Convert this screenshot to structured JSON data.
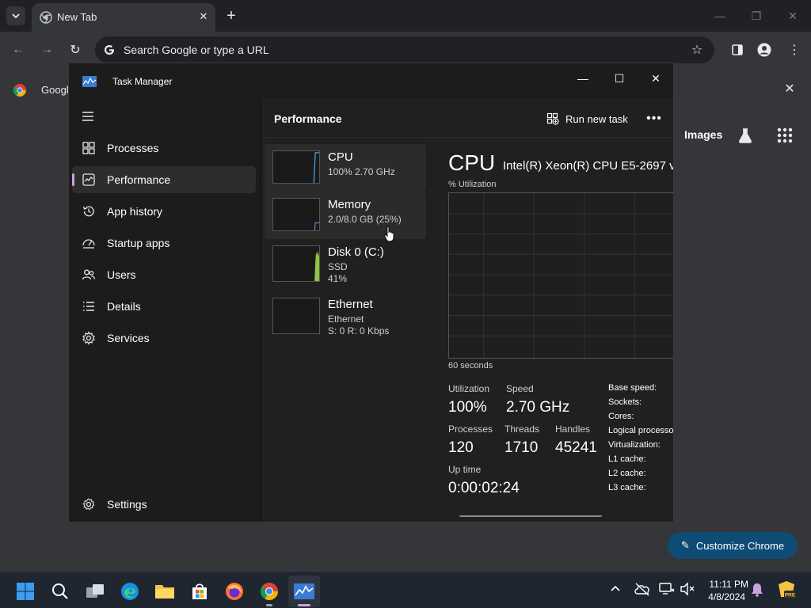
{
  "chrome": {
    "tab_title": "New Tab",
    "omnibox_placeholder": "Search Google or type a URL",
    "bookmark_label": "Googl",
    "images_label": "Images",
    "customize_label": "Customize Chrome"
  },
  "taskmanager": {
    "window_title": "Task Manager",
    "nav": [
      {
        "label": "Processes",
        "icon": "processes-icon"
      },
      {
        "label": "Performance",
        "icon": "performance-icon",
        "selected": true
      },
      {
        "label": "App history",
        "icon": "history-icon"
      },
      {
        "label": "Startup apps",
        "icon": "startup-icon"
      },
      {
        "label": "Users",
        "icon": "users-icon"
      },
      {
        "label": "Details",
        "icon": "details-icon"
      },
      {
        "label": "Services",
        "icon": "services-icon"
      }
    ],
    "settings_label": "Settings",
    "page_title": "Performance",
    "run_new_task": "Run new task",
    "resources": [
      {
        "name": "CPU",
        "line1": "100% 2.70 GHz",
        "line2": ""
      },
      {
        "name": "Memory",
        "line1": "2.0/8.0 GB (25%)",
        "line2": ""
      },
      {
        "name": "Disk 0 (C:)",
        "line1": "SSD",
        "line2": "41%"
      },
      {
        "name": "Ethernet",
        "line1": "Ethernet",
        "line2": "S: 0 R: 0 Kbps"
      }
    ],
    "cpu": {
      "title": "CPU",
      "model": "Intel(R) Xeon(R) CPU E5-2697 v",
      "util_label": "% Utilization",
      "seconds_label": "60 seconds",
      "utilization_label": "Utilization",
      "utilization": "100%",
      "speed_label": "Speed",
      "speed": "2.70 GHz",
      "processes_label": "Processes",
      "processes": "120",
      "threads_label": "Threads",
      "threads": "1710",
      "handles_label": "Handles",
      "handles": "45241",
      "uptime_label": "Up time",
      "uptime": "0:00:02:24",
      "info": [
        "Base speed:",
        "Sockets:",
        "Cores:",
        "Logical processo",
        "Virtualization:",
        "L1 cache:",
        "L2 cache:",
        "L3 cache:"
      ]
    }
  },
  "taskbar": {
    "time": "11:11 PM",
    "date": "4/8/2024"
  },
  "colors": {
    "accent": "#c9a3dc",
    "customize_bg": "#0f4c75",
    "disk_graph": "#8ec63f",
    "cpu_graph": "#4aa3df"
  }
}
